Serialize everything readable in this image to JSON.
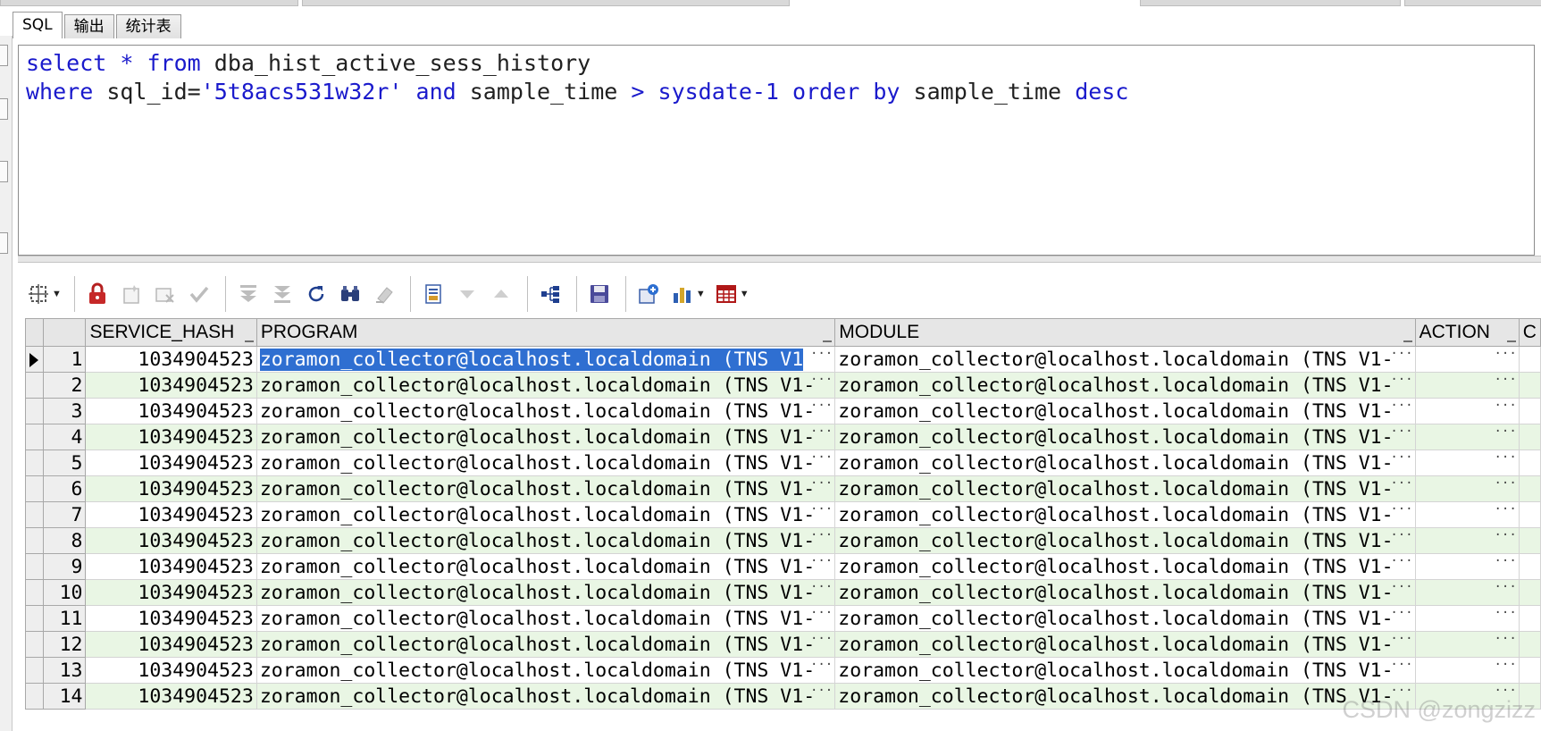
{
  "tabs": [
    {
      "label": "SQL",
      "active": true
    },
    {
      "label": "输出",
      "active": false
    },
    {
      "label": "统计表",
      "active": false
    }
  ],
  "editor": {
    "line1": {
      "k1": "select",
      "op1": "*",
      "k2": "from",
      "t1": "dba_hist_active_sess_history"
    },
    "line2": {
      "k1": "where",
      "t1": "sql_id=",
      "s1": "'5t8acs531w32r'",
      "k2": "and",
      "t2": "sample_time",
      "op1": ">",
      "k3": "sysdate-1",
      "k4": "order",
      "k5": "by",
      "t3": "sample_time",
      "k6": "desc"
    }
  },
  "toolbar": {
    "icons": [
      "query-builder-icon",
      "lock-icon",
      "insert-record-icon",
      "delete-record-icon",
      "post-changes-icon",
      "first-record-icon",
      "last-record-icon",
      "refresh-icon",
      "find-icon",
      "clear-icon",
      "export-icon",
      "filter-down-icon",
      "filter-up-icon",
      "tree-view-icon",
      "save-icon",
      "import-icon",
      "chart-icon",
      "grid-view-icon"
    ]
  },
  "grid": {
    "columns": [
      "SERVICE_HASH",
      "PROGRAM",
      "MODULE",
      "ACTION",
      "C"
    ],
    "rows": [
      {
        "n": "1",
        "service_hash": "1034904523",
        "program": "zoramon_collector@localhost.localdomain (TNS V1",
        "module": "zoramon_collector@localhost.localdomain (TNS V1-",
        "action": ""
      },
      {
        "n": "2",
        "service_hash": "1034904523",
        "program": "zoramon_collector@localhost.localdomain (TNS V1-",
        "module": "zoramon_collector@localhost.localdomain (TNS V1-",
        "action": ""
      },
      {
        "n": "3",
        "service_hash": "1034904523",
        "program": "zoramon_collector@localhost.localdomain (TNS V1-",
        "module": "zoramon_collector@localhost.localdomain (TNS V1-",
        "action": ""
      },
      {
        "n": "4",
        "service_hash": "1034904523",
        "program": "zoramon_collector@localhost.localdomain (TNS V1-",
        "module": "zoramon_collector@localhost.localdomain (TNS V1-",
        "action": ""
      },
      {
        "n": "5",
        "service_hash": "1034904523",
        "program": "zoramon_collector@localhost.localdomain (TNS V1-",
        "module": "zoramon_collector@localhost.localdomain (TNS V1-",
        "action": ""
      },
      {
        "n": "6",
        "service_hash": "1034904523",
        "program": "zoramon_collector@localhost.localdomain (TNS V1-",
        "module": "zoramon_collector@localhost.localdomain (TNS V1-",
        "action": ""
      },
      {
        "n": "7",
        "service_hash": "1034904523",
        "program": "zoramon_collector@localhost.localdomain (TNS V1-",
        "module": "zoramon_collector@localhost.localdomain (TNS V1-",
        "action": ""
      },
      {
        "n": "8",
        "service_hash": "1034904523",
        "program": "zoramon_collector@localhost.localdomain (TNS V1-",
        "module": "zoramon_collector@localhost.localdomain (TNS V1-",
        "action": ""
      },
      {
        "n": "9",
        "service_hash": "1034904523",
        "program": "zoramon_collector@localhost.localdomain (TNS V1-",
        "module": "zoramon_collector@localhost.localdomain (TNS V1-",
        "action": ""
      },
      {
        "n": "10",
        "service_hash": "1034904523",
        "program": "zoramon_collector@localhost.localdomain (TNS V1-",
        "module": "zoramon_collector@localhost.localdomain (TNS V1-",
        "action": ""
      },
      {
        "n": "11",
        "service_hash": "1034904523",
        "program": "zoramon_collector@localhost.localdomain (TNS V1-",
        "module": "zoramon_collector@localhost.localdomain (TNS V1-",
        "action": ""
      },
      {
        "n": "12",
        "service_hash": "1034904523",
        "program": "zoramon_collector@localhost.localdomain (TNS V1-",
        "module": "zoramon_collector@localhost.localdomain (TNS V1-",
        "action": ""
      },
      {
        "n": "13",
        "service_hash": "1034904523",
        "program": "zoramon_collector@localhost.localdomain (TNS V1-",
        "module": "zoramon_collector@localhost.localdomain (TNS V1-",
        "action": ""
      },
      {
        "n": "14",
        "service_hash": "1034904523",
        "program": "zoramon_collector@localhost.localdomain (TNS V1-",
        "module": "zoramon_collector@localhost.localdomain (TNS V1-",
        "action": ""
      }
    ],
    "ellipsis": "···"
  },
  "watermark": "CSDN @zongzizz",
  "colors": {
    "keyword": "#1a1acc",
    "selection": "#2f6fd1",
    "row_alt": "#e9f6e4"
  }
}
